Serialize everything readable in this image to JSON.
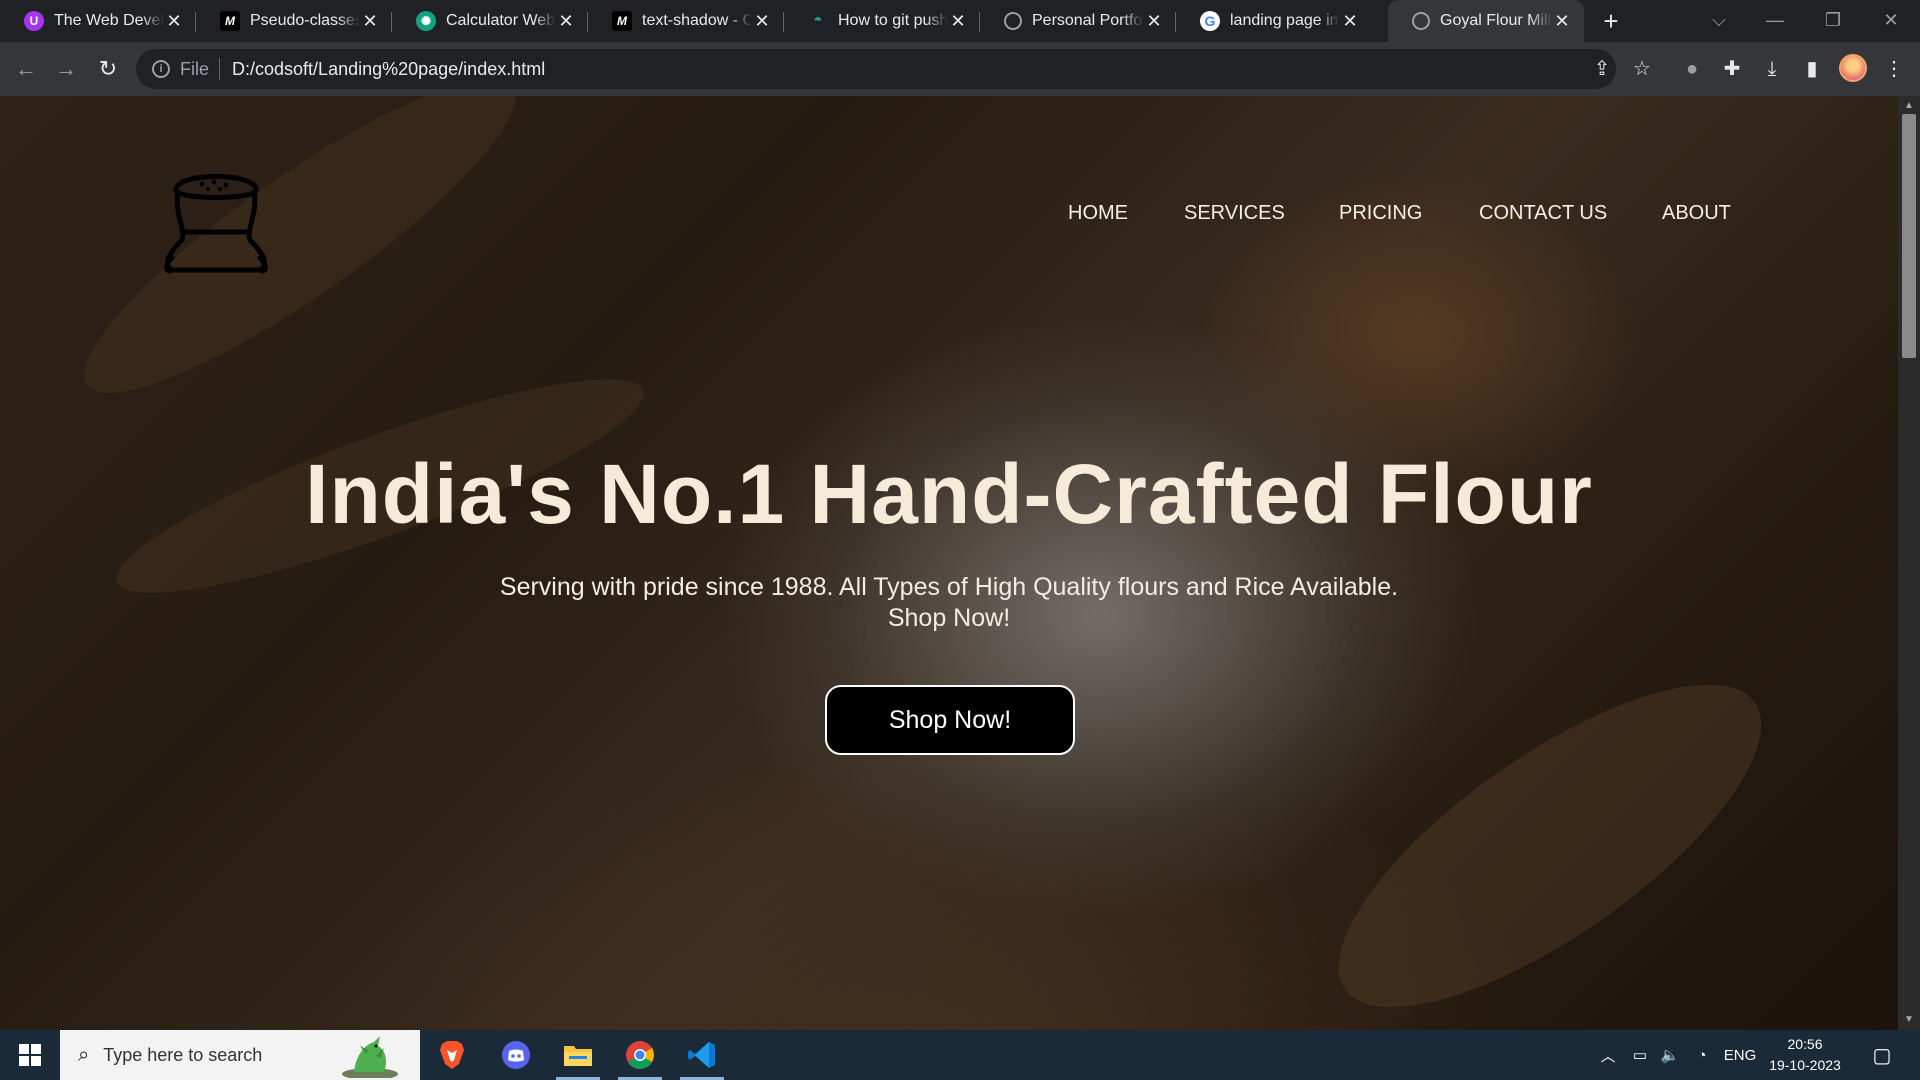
{
  "browser": {
    "tabs": [
      {
        "title": "The Web Developer",
        "icon": "udemy-icon",
        "color": "#a435f0",
        "glyph": "U"
      },
      {
        "title": "Pseudo-classes - CSS",
        "icon": "mdn-icon",
        "color": "#000000",
        "glyph": "M"
      },
      {
        "title": "Calculator Website",
        "icon": "chatgpt-icon",
        "color": "#10a37f",
        "glyph": "⚙"
      },
      {
        "title": "text-shadow - CSS",
        "icon": "mdn-icon",
        "color": "#000000",
        "glyph": "M"
      },
      {
        "title": "How to git push",
        "icon": "github-copilot-icon",
        "color": "#1b9e8a",
        "glyph": "◓"
      },
      {
        "title": "Personal Portfolio",
        "icon": "globe-icon",
        "color": "#5f6368",
        "glyph": "◎"
      },
      {
        "title": "landing page images",
        "icon": "google-icon",
        "color": "#ffffff",
        "glyph": "G"
      },
      {
        "title": "Goyal Flour Mill",
        "icon": "globe-icon",
        "color": "#5f6368",
        "glyph": "◎"
      }
    ],
    "active_tab": 7,
    "new_tab": "+",
    "url_scheme": "File",
    "url": "D:/codsoft/Landing%20page/index.html"
  },
  "page": {
    "nav": [
      "HOME",
      "SERVICES",
      "PRICING",
      "CONTACT US",
      "ABOUT"
    ],
    "hero_title": "India's No.1 Hand-Crafted Flour",
    "hero_sub_line1": "Serving with pride since 1988. All Types of High Quality flours and Rice Available.",
    "hero_sub_line2": "Shop Now!",
    "cta": "Shop Now!",
    "colors": {
      "title": "#f6ead8",
      "cta_bg": "#000000",
      "cta_border": "#ffffff"
    }
  },
  "taskbar": {
    "search_placeholder": "Type here to search",
    "apps": [
      "brave-icon",
      "discord-icon",
      "file-explorer-icon",
      "chrome-icon",
      "vscode-icon"
    ],
    "lang": "ENG",
    "time": "20:56",
    "date": "19-10-2023"
  }
}
